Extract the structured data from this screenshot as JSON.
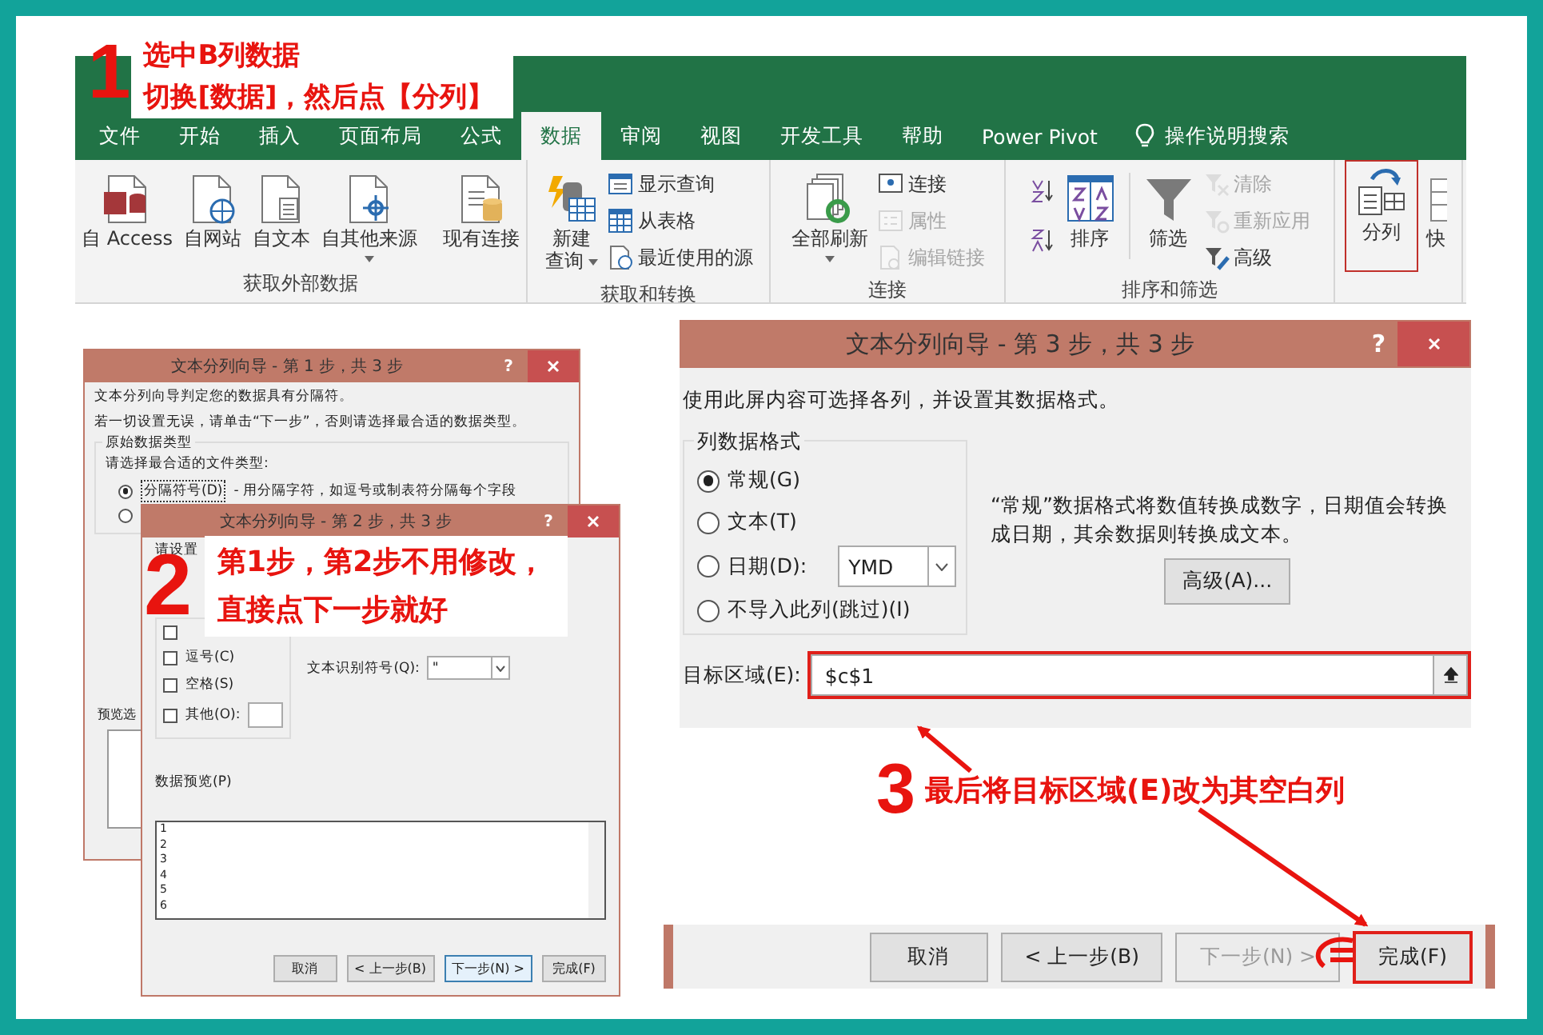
{
  "ribbon": {
    "tabs": [
      {
        "label": "文件",
        "selected": false
      },
      {
        "label": "开始",
        "selected": false
      },
      {
        "label": "插入",
        "selected": false
      },
      {
        "label": "页面布局",
        "selected": false
      },
      {
        "label": "公式",
        "selected": false
      },
      {
        "label": "数据",
        "selected": true
      },
      {
        "label": "审阅",
        "selected": false
      },
      {
        "label": "视图",
        "selected": false
      },
      {
        "label": "开发工具",
        "selected": false
      },
      {
        "label": "帮助",
        "selected": false
      },
      {
        "label": "Power Pivot",
        "selected": false
      }
    ],
    "tell_me": "操作说明搜索",
    "groups": [
      {
        "label": "获取外部数据",
        "items": [
          {
            "kind": "large",
            "label": "自 Access",
            "dropdown": false,
            "disabled": false,
            "highlighted": false
          },
          {
            "kind": "large",
            "label": "自网站",
            "dropdown": false,
            "disabled": false,
            "highlighted": false
          },
          {
            "kind": "large",
            "label": "自文本",
            "dropdown": false,
            "disabled": false,
            "highlighted": false
          },
          {
            "kind": "large",
            "label": "自其他来源",
            "dropdown": true,
            "disabled": false,
            "highlighted": false
          },
          {
            "kind": "separator"
          },
          {
            "kind": "large",
            "label": "现有连接",
            "dropdown": false,
            "disabled": false,
            "highlighted": false
          }
        ]
      },
      {
        "label": "获取和转换",
        "items": [
          {
            "kind": "large",
            "label_lines": [
              "新建",
              "查询"
            ],
            "dropdown": true,
            "disabled": false,
            "highlighted": false
          },
          {
            "kind": "small",
            "label": "显示查询",
            "disabled": false
          },
          {
            "kind": "small",
            "label": "从表格",
            "disabled": false
          },
          {
            "kind": "small",
            "label": "最近使用的源",
            "disabled": false
          }
        ]
      },
      {
        "label": "连接",
        "items": [
          {
            "kind": "large",
            "label": "全部刷新",
            "dropdown": true,
            "disabled": false,
            "highlighted": false
          },
          {
            "kind": "small",
            "label": "连接",
            "disabled": false
          },
          {
            "kind": "small",
            "label": "属性",
            "disabled": true
          },
          {
            "kind": "small",
            "label": "编辑链接",
            "disabled": true
          }
        ]
      },
      {
        "label": "排序和筛选",
        "items": [
          {
            "kind": "small",
            "disabled": false
          },
          {
            "kind": "small",
            "disabled": false
          },
          {
            "kind": "large",
            "label": "排序",
            "dropdown": false,
            "disabled": false,
            "highlighted": false
          },
          {
            "kind": "separator"
          },
          {
            "kind": "large",
            "label": "筛选",
            "dropdown": false,
            "disabled": false,
            "highlighted": false
          },
          {
            "kind": "small",
            "label": "清除",
            "disabled": true
          },
          {
            "kind": "small",
            "label": "重新应用",
            "disabled": true
          },
          {
            "kind": "small",
            "label": "高级",
            "disabled": false
          }
        ]
      },
      {
        "items": [
          {
            "kind": "large",
            "label": "分列",
            "dropdown": false,
            "disabled": false,
            "highlighted": true
          },
          {
            "kind": "large",
            "label": "快",
            "dropdown": false,
            "disabled": false,
            "highlighted": false
          }
        ]
      }
    ]
  },
  "dialogs": [
    {
      "title": "文本分列向导 - 第 1 步，共 3 步",
      "help": "?",
      "texts": [
        "文本分列向导判定您的数据具有分隔符。",
        "若一切设置无误，请单击“下一步”，否则请选择最合适的数据类型。"
      ],
      "group_label": "原始数据类型",
      "prompt": "请选择最合适的文件类型:",
      "options": [
        {
          "label": "分隔符号(D)",
          "description": "- 用分隔字符，如逗号或制表符分隔每个字段",
          "selected": true
        },
        {
          "selected": false
        }
      ],
      "preview_label": "预览选"
    },
    {
      "title": "文本分列向导 - 第 2 步，共 3 步",
      "help": "?",
      "group_label": "请设置",
      "delimiters": [
        {
          "checked": false
        },
        {
          "label": "逗号(C)",
          "checked": false
        },
        {
          "label": "空格(S)",
          "checked": false
        },
        {
          "label": "其他(O):",
          "checked": false
        }
      ],
      "qualifier_label": "文本识别符号(Q):",
      "qualifier_value": "\"",
      "preview_label": "数据预览(P)",
      "preview_rows": [
        "1",
        "2",
        "3",
        "4",
        "5",
        "6"
      ],
      "buttons": [
        {
          "label": "取消",
          "default": false
        },
        {
          "label": "< 上一步(B)",
          "default": false
        },
        {
          "label": "下一步(N) >",
          "default": true
        },
        {
          "label": "完成(F)",
          "default": false
        }
      ]
    },
    {
      "title": "文本分列向导 - 第 3 步，共 3 步",
      "help": "?",
      "intro": "使用此屏内容可选择各列，并设置其数据格式。",
      "format_label": "列数据格式",
      "formats": [
        {
          "label": "常规(G)",
          "selected": true
        },
        {
          "label": "文本(T)",
          "selected": false
        },
        {
          "label": "日期(D):",
          "selected": false
        },
        {
          "label": "不导入此列(跳过)(I)",
          "selected": false
        }
      ],
      "date_value": "YMD",
      "description": "“常规”数据格式将数值转换成数字，日期值会转换成日期，其余数据则转换成文本。",
      "advanced_button": "高级(A)...",
      "destination_label": "目标区域(E):",
      "destination_value": "$c$1",
      "destination_highlighted": true,
      "buttons": [
        {
          "label": "取消",
          "disabled": false,
          "highlighted": false
        },
        {
          "label": "< 上一步(B)",
          "disabled": false,
          "highlighted": false
        },
        {
          "label": "下一步(N) >",
          "disabled": true,
          "highlighted": false
        },
        {
          "label": "完成(F)",
          "disabled": false,
          "highlighted": true
        }
      ]
    }
  ],
  "callouts": [
    {
      "number": "1",
      "lines": [
        "选中B列数据",
        "切换[数据]，然后点【分列】"
      ]
    },
    {
      "number": "2",
      "lines": [
        "第1步，第2步不用修改，",
        "直接点下一步就好"
      ]
    },
    {
      "number": "3",
      "lines": [
        "最后将目标区域(E)改为其空白列"
      ]
    }
  ]
}
